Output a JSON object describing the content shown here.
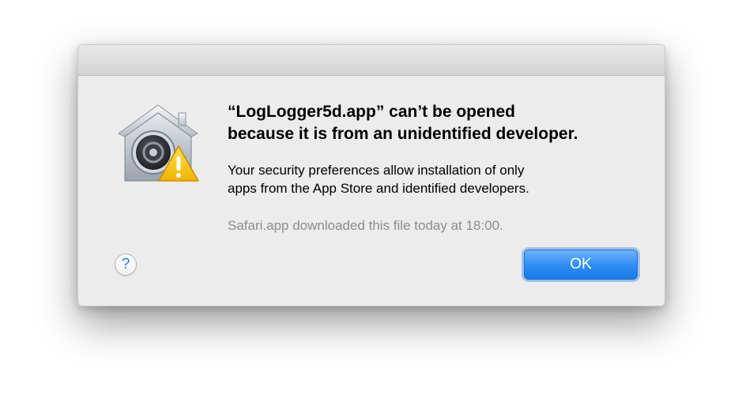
{
  "dialog": {
    "headline_line1": "“LogLogger5d.app” can’t be opened",
    "headline_line2": "because it is from an unidentified developer.",
    "body_line1": "Your security preferences allow installation of only",
    "body_line2": "apps from the App Store and identified developers.",
    "download_note": "Safari.app downloaded this file today at 18:00.",
    "help_label": "?",
    "ok_label": "OK",
    "icon": "gatekeeper-warning-icon"
  },
  "colors": {
    "accent": "#2e8cf3",
    "help_text": "#2a7ae0",
    "secondary_text": "#8c8c8c",
    "warning": "#f5c400"
  }
}
